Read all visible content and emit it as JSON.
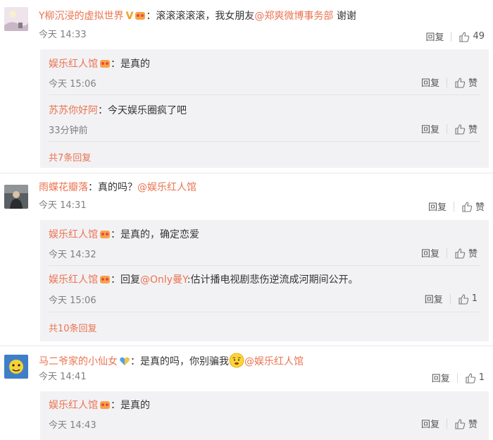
{
  "comments": [
    {
      "user": "Y柳沉浸的虚拟世界",
      "verified": "V",
      "text": "：滚滚滚滚滚，我女朋友",
      "mention": "@郑爽微博事务部",
      "text_after": " 谢谢",
      "time": "今天 14:33",
      "reply_label": "回复",
      "like_count": "49",
      "replies": [
        {
          "user": "娱乐红人馆",
          "text": "：是真的",
          "time": "今天 15:06",
          "reply_label": "回复",
          "like_label": "赞"
        },
        {
          "user": "苏苏你好阿",
          "text": "：今天娱乐圈疯了吧",
          "time": "33分钟前",
          "reply_label": "回复",
          "like_label": "赞"
        }
      ],
      "more": "共7条回复"
    },
    {
      "user": "雨蝶花瓣落",
      "text": "：真的吗？",
      "mention": "@娱乐红人馆",
      "time": "今天 14:31",
      "reply_label": "回复",
      "like_label": "赞",
      "replies": [
        {
          "user": "娱乐红人馆",
          "text": "：是真的，确定恋爱",
          "time": "今天 14:32",
          "reply_label": "回复",
          "like_label": "赞"
        },
        {
          "user": "娱乐红人馆",
          "text_pre": "：回复",
          "mention": "@Only曼Y",
          "text": ":估计播电视剧悲伤逆流成河期间公开。",
          "time": "今天 15:06",
          "reply_label": "回复",
          "like_count": "1"
        }
      ],
      "more": "共10条回复"
    },
    {
      "user": "马二爷家的小仙女",
      "text": "：是真的吗，你别骗我",
      "mention": "@娱乐红人馆",
      "time": "今天 14:41",
      "reply_label": "回复",
      "like_count": "1",
      "replies": [
        {
          "user": "娱乐红人馆",
          "text": "：是真的",
          "time": "今天 14:43",
          "reply_label": "回复",
          "like_label": "赞"
        }
      ]
    }
  ],
  "colors": {
    "accent": "#eb7350",
    "reply_bg": "#f2f2f5",
    "meta": "#808080"
  }
}
